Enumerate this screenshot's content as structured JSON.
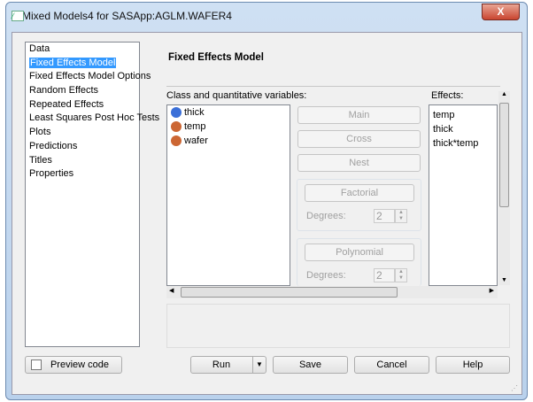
{
  "window": {
    "title": "Mixed Models4 for SASApp:AGLM.WAFER4",
    "close_label": "X"
  },
  "nav": {
    "items": [
      "Data",
      "Fixed Effects Model",
      "Fixed Effects Model Options",
      "Random Effects",
      "Repeated Effects",
      "Least Squares Post Hoc Tests",
      "Plots",
      "Predictions",
      "Titles",
      "Properties"
    ],
    "selected": 1
  },
  "panel": {
    "heading": "Fixed Effects Model",
    "variables_label": "Class and quantitative variables:",
    "effects_label": "Effects:",
    "variables": [
      {
        "name": "thick",
        "type": "quantitative"
      },
      {
        "name": "temp",
        "type": "class"
      },
      {
        "name": "wafer",
        "type": "class"
      }
    ],
    "buttons": {
      "main": "Main",
      "cross": "Cross",
      "nest": "Nest",
      "factorial": "Factorial",
      "polynomial": "Polynomial"
    },
    "degrees_label": "Degrees:",
    "factorial_degrees": "2",
    "polynomial_degrees": "2",
    "effects": [
      "temp",
      "thick",
      "thick*temp"
    ]
  },
  "footer": {
    "preview": "Preview code",
    "run": "Run",
    "save": "Save",
    "cancel": "Cancel",
    "help": "Help"
  }
}
